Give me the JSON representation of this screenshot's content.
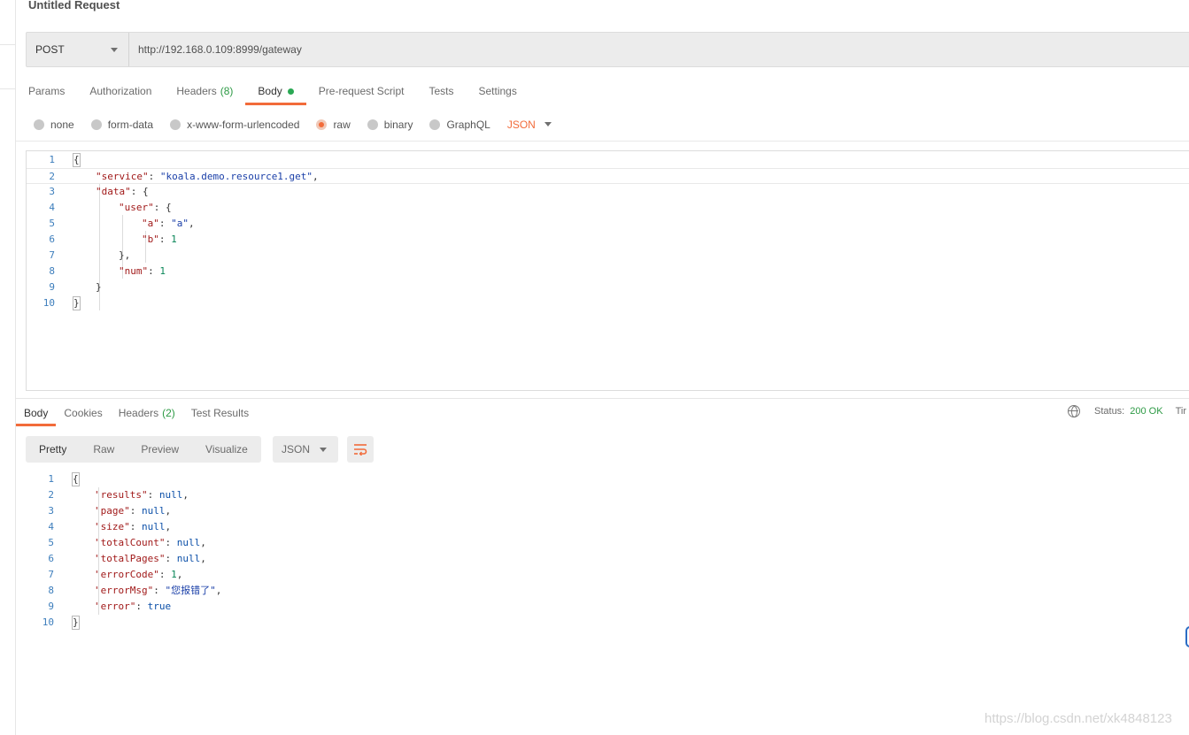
{
  "request": {
    "title": "Untitled Request",
    "method": "POST",
    "url": "http://192.168.0.109:8999/gateway"
  },
  "request_tabs": [
    {
      "label": "Params"
    },
    {
      "label": "Authorization"
    },
    {
      "label": "Headers",
      "count": "(8)"
    },
    {
      "label": "Body"
    },
    {
      "label": "Pre-request Script"
    },
    {
      "label": "Tests"
    },
    {
      "label": "Settings"
    }
  ],
  "body_options": {
    "items": [
      "none",
      "form-data",
      "x-www-form-urlencoded",
      "raw",
      "binary",
      "GraphQL"
    ],
    "selected": "raw",
    "language": "JSON"
  },
  "request_body_lines": [
    {
      "n": "1",
      "text": "{"
    },
    {
      "n": "2",
      "key": "\"service\"",
      "sep": ": ",
      "val": "\"koala.demo.resource1.get\"",
      "vt": "s",
      "tail": ","
    },
    {
      "n": "3",
      "key": "\"data\"",
      "sep": ": ",
      "tail": "{"
    },
    {
      "n": "4",
      "key": "\"user\"",
      "sep": ": ",
      "tail": "{"
    },
    {
      "n": "5",
      "key": "\"a\"",
      "sep": ": ",
      "val": "\"a\"",
      "vt": "s",
      "tail": ","
    },
    {
      "n": "6",
      "key": "\"b\"",
      "sep": ": ",
      "val": "1",
      "vt": "n",
      "tail": ""
    },
    {
      "n": "7",
      "text": "},"
    },
    {
      "n": "8",
      "key": "\"num\"",
      "sep": ": ",
      "val": "1",
      "vt": "n",
      "tail": ""
    },
    {
      "n": "9",
      "text": "}"
    },
    {
      "n": "10",
      "text": "}"
    }
  ],
  "response_tabs": [
    {
      "label": "Body"
    },
    {
      "label": "Cookies"
    },
    {
      "label": "Headers",
      "count": "(2)"
    },
    {
      "label": "Test Results"
    }
  ],
  "response_status": {
    "label": "Status:",
    "value": "200 OK",
    "time_label": "Tir"
  },
  "response_views": [
    "Pretty",
    "Raw",
    "Preview",
    "Visualize"
  ],
  "response_format": "JSON",
  "response_body_lines": [
    {
      "n": "1",
      "text": "{"
    },
    {
      "n": "2",
      "key": "\"results\"",
      "sep": ": ",
      "val": "null",
      "vt": "b",
      "tail": ","
    },
    {
      "n": "3",
      "key": "\"page\"",
      "sep": ": ",
      "val": "null",
      "vt": "b",
      "tail": ","
    },
    {
      "n": "4",
      "key": "\"size\"",
      "sep": ": ",
      "val": "null",
      "vt": "b",
      "tail": ","
    },
    {
      "n": "5",
      "key": "\"totalCount\"",
      "sep": ": ",
      "val": "null",
      "vt": "b",
      "tail": ","
    },
    {
      "n": "6",
      "key": "\"totalPages\"",
      "sep": ": ",
      "val": "null",
      "vt": "b",
      "tail": ","
    },
    {
      "n": "7",
      "key": "\"errorCode\"",
      "sep": ": ",
      "val": "1",
      "vt": "n",
      "tail": ","
    },
    {
      "n": "8",
      "key": "\"errorMsg\"",
      "sep": ": ",
      "val": "\"您报错了\"",
      "vt": "s",
      "tail": ","
    },
    {
      "n": "9",
      "key": "\"error\"",
      "sep": ": ",
      "val": "true",
      "vt": "b",
      "tail": ""
    },
    {
      "n": "10",
      "text": "}"
    }
  ],
  "watermark": "https://blog.csdn.net/xk4848123",
  "colors": {
    "accent": "#f26b3a",
    "success": "#2d9a45",
    "json_key": "#a11a1a",
    "json_string": "#1a3fa8",
    "json_number": "#098658"
  }
}
